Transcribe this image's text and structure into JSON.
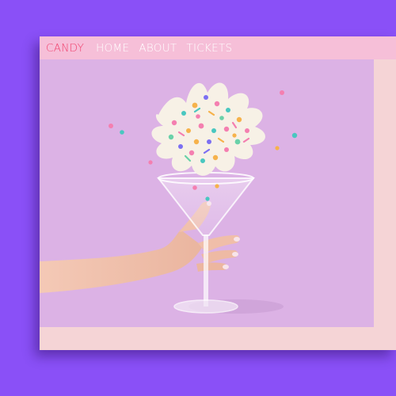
{
  "nav": {
    "brand": "CANDY",
    "items": [
      {
        "label": "HOME"
      },
      {
        "label": "ABOUT"
      },
      {
        "label": "TICKETS"
      }
    ]
  },
  "hero": {
    "image": "hand-holding-martini-glass-with-exploding-sprinkles"
  },
  "colors": {
    "page_background": "#8a50f7",
    "navbar": "#f6bfd8",
    "brand_text": "#f0436e",
    "hero_background": "#dcb2e5",
    "window_background": "#f5d4d6"
  }
}
